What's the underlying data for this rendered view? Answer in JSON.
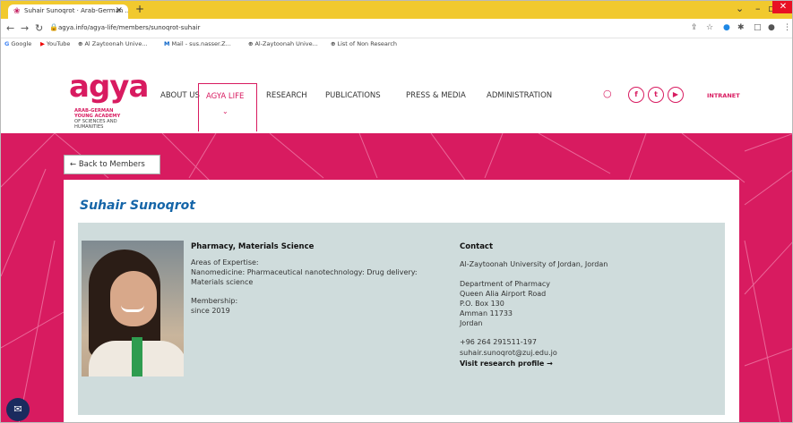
{
  "browser": {
    "tab_title": "Suhair Sunoqrot · Arab-German ...",
    "close_tab": "×",
    "new_tab": "+",
    "url": "agya.info/agya-life/members/sunoqrot-suhair",
    "bookmarks": [
      {
        "icon": "G",
        "label": "Google"
      },
      {
        "icon": "▶",
        "label": "YouTube"
      },
      {
        "icon": "⊕",
        "label": "Al Zaytoonah Unive..."
      },
      {
        "icon": "M",
        "label": "Mail - sus.nasser.Z..."
      },
      {
        "icon": "⊕",
        "label": "Al-Zaytoonah Unive..."
      },
      {
        "icon": "⊕",
        "label": "List of Non Research"
      }
    ]
  },
  "site": {
    "logo_word": "agya",
    "logo_sub1": "ARAB-GERMAN",
    "logo_sub2": "YOUNG ACADEMY",
    "logo_sub3": "OF SCIENCES AND",
    "logo_sub4": "HUMANITIES",
    "nav": {
      "about": "ABOUT US",
      "agyalife": "AGYA LIFE",
      "research": "RESEARCH",
      "publications": "PUBLICATIONS",
      "press": "PRESS & MEDIA",
      "admin": "ADMINISTRATION"
    },
    "social": {
      "facebook": "f",
      "twitter": "t",
      "youtube": "▶"
    },
    "intranet": "INTRANET"
  },
  "profile": {
    "back_label": "← Back to Members",
    "name": "Suhair Sunoqrot",
    "field": "Pharmacy, Materials Science",
    "areas_label": "Areas of Expertise:",
    "areas_line1": "Nanomedicine: Pharmaceutical nanotechnology: Drug delivery:",
    "areas_line2": "Materials science",
    "membership_label": "Membership:",
    "membership_value": "since 2019",
    "contact_heading": "Contact",
    "institution": "Al-Zaytoonah University of Jordan, Jordan",
    "addr1": "Department of Pharmacy",
    "addr2": "Queen Alia Airport Road",
    "addr3": "P.O. Box 130",
    "addr4": "Amman 11733",
    "addr5": "Jordan",
    "phone": "+96 264 291511-197",
    "email": "suhair.sunoqrot@zuj.edu.jo",
    "visit": "Visit research profile →"
  },
  "colors": {
    "brand_pink": "#d81b60",
    "title_blue": "#1565a8",
    "info_bg": "#cfdcdc",
    "tab_strip": "#f1c92e"
  }
}
